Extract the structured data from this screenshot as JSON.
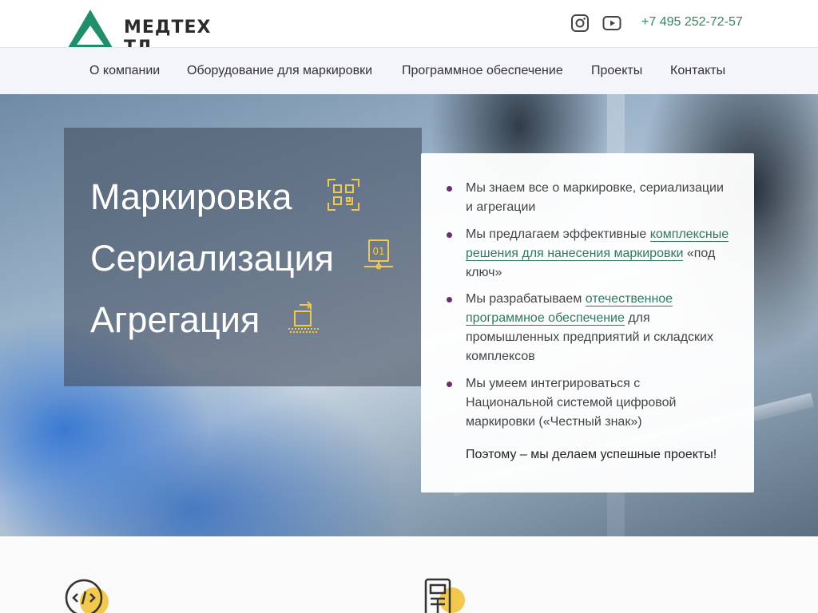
{
  "header": {
    "brand": "МЕДТЕХ ТД",
    "phone": "+7 495 252-72-57",
    "icons": [
      "triangle-logo-icon",
      "instagram-icon",
      "youtube-icon"
    ],
    "colors": {
      "brand_green": "#2f8a5f",
      "logo_green": "#1f8f6a"
    }
  },
  "nav": {
    "items": [
      {
        "label": "О компании"
      },
      {
        "label": "Оборудование для маркировки"
      },
      {
        "label": "Программное обеспечение"
      },
      {
        "label": "Проекты"
      },
      {
        "label": "Контакты"
      }
    ]
  },
  "hero": {
    "titles": [
      {
        "text": "Маркировка",
        "icon": "qr-code-icon"
      },
      {
        "text": "Сериализация",
        "icon": "serial-number-icon"
      },
      {
        "text": "Агрегация",
        "icon": "box-aggregation-icon"
      }
    ],
    "bullets": [
      {
        "before": "Мы знаем все о маркировке, сериализации и агрегации",
        "link": "",
        "after": ""
      },
      {
        "before": "Мы предлагаем эффективные ",
        "link": "комплексные решения для нанесения маркировки",
        "after": " «под ключ»"
      },
      {
        "before": "Мы разрабатываем ",
        "link": "отечественное программное обеспечение",
        "after": " для промышленных предприятий и складских комплексов"
      },
      {
        "before": "Мы умеем интегрироваться с Национальной системой цифровой маркировки («Честный знак»)",
        "link": "",
        "after": ""
      }
    ],
    "summary": "Поэтому – мы делаем успешные проекты!",
    "colors": {
      "icon_yellow": "#f2c94c",
      "bullet": "#6b2f6b",
      "link": "#2f7a5a"
    }
  },
  "features": {
    "icons": [
      "code-icon",
      "handheld-scanner-icon"
    ]
  }
}
